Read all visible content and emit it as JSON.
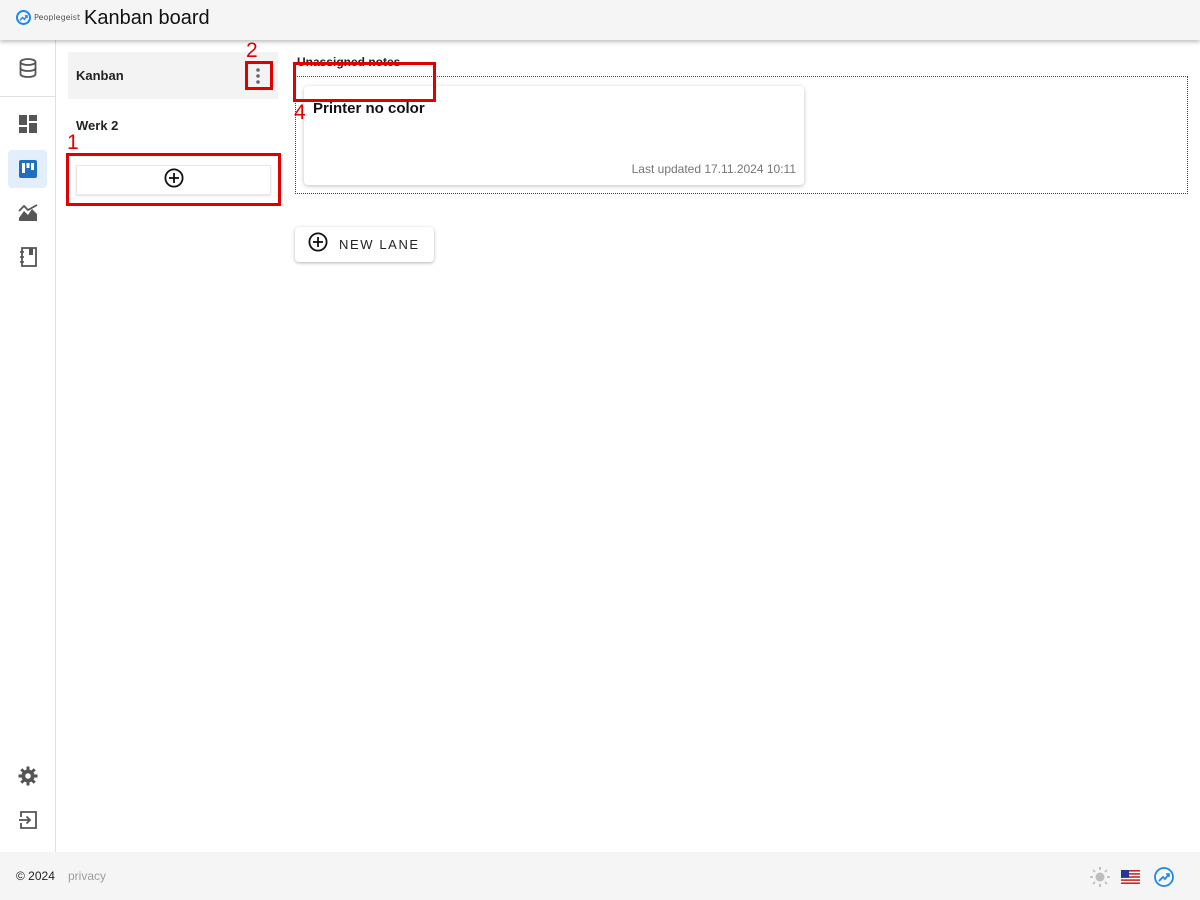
{
  "header": {
    "logo_text": "Peoplegeist",
    "title": "Kanban board"
  },
  "rail": {
    "items": [
      {
        "icon": "database-icon",
        "active": false
      },
      {
        "icon": "dashboard-icon",
        "active": false
      },
      {
        "icon": "kanban-icon",
        "active": true
      },
      {
        "icon": "area-chart-icon",
        "active": false
      },
      {
        "icon": "notebook-icon",
        "active": false
      }
    ],
    "bottom": [
      "settings-icon",
      "logout-icon"
    ]
  },
  "boards": {
    "items": [
      {
        "label": "Kanban",
        "active": true
      },
      {
        "label": "Werk 2",
        "active": false
      }
    ],
    "add_icon": "add-circle-icon"
  },
  "lane": {
    "title": "Unassigned notes",
    "cards": [
      {
        "title": "Printer no color",
        "updated": "Last updated 17.11.2024 10:11"
      }
    ]
  },
  "new_lane": {
    "label": "NEW LANE"
  },
  "footer": {
    "copyright": "© 2024",
    "privacy": "privacy",
    "icons": [
      "sun-icon",
      "us-flag-icon",
      "peoplegeist-logo-icon"
    ]
  },
  "annotations": [
    "1",
    "2",
    "4"
  ],
  "colors": {
    "accent": "#1e6fbf",
    "marker": "#e00000"
  }
}
